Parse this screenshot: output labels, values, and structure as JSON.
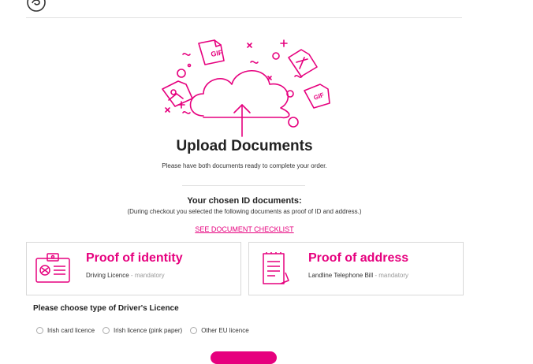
{
  "header": {
    "logo_icon": "brand-swirl-icon"
  },
  "colors": {
    "accent": "#e6007e",
    "text": "#222222",
    "muted": "#999999",
    "border": "#d9d9d9"
  },
  "hero": {
    "illustration": "cloud-upload-icon",
    "file_icons": [
      "gif-file-icon",
      "pdf-file-icon",
      "image-file-icon",
      "gif-file-icon"
    ],
    "file_labels": [
      "GIF",
      "GIF"
    ]
  },
  "upload": {
    "title": "Upload Documents",
    "subtitle": "Please have both documents ready to complete your order."
  },
  "chosen": {
    "title": "Your chosen ID documents:",
    "subtitle": "(During checkout you selected the following documents as proof of ID and address.)",
    "checklist_link": "SEE DOCUMENT CHECKLIST"
  },
  "cards": {
    "identity": {
      "icon": "id-badge-icon",
      "title": "Proof of identity",
      "document": "Driving Licence",
      "mandatory": " - mandatory"
    },
    "address": {
      "icon": "document-bill-icon",
      "title": "Proof of address",
      "document": "Landline Telephone Bill",
      "mandatory": " - mandatory"
    }
  },
  "licence": {
    "title": "Please choose type of Driver's Licence",
    "options": [
      "Irish card licence",
      "Irish licence (pink paper)",
      "Other EU licence"
    ]
  }
}
